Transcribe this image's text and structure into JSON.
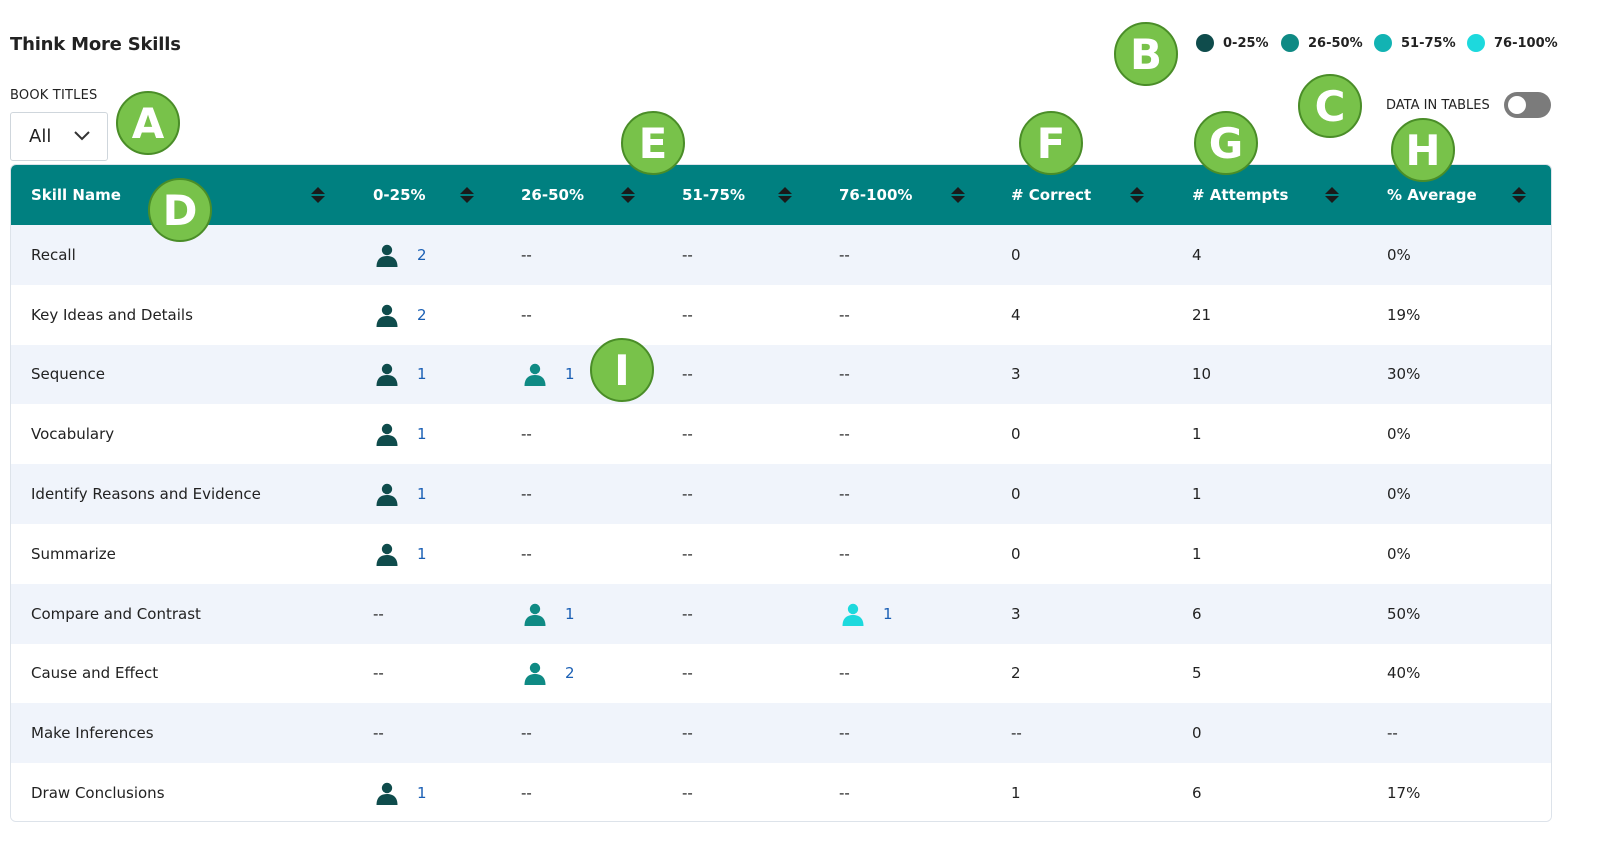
{
  "page": {
    "title": "Think More Skills"
  },
  "filter": {
    "label": "BOOK TITLES",
    "value": "All"
  },
  "legend": [
    {
      "label": "0-25%",
      "color": "#0f4c4c"
    },
    {
      "label": "26-50%",
      "color": "#0f8a84"
    },
    {
      "label": "51-75%",
      "color": "#12b3b3"
    },
    {
      "label": "76-100%",
      "color": "#1dd9dd"
    }
  ],
  "toggle": {
    "label": "DATA IN TABLES",
    "on": false
  },
  "table": {
    "columns": [
      "Skill Name",
      "0-25%",
      "26-50%",
      "51-75%",
      "76-100%",
      "# Correct",
      "# Attempts",
      "% Average"
    ],
    "rows": [
      {
        "name": "Recall",
        "b": [
          "2",
          "--",
          "--",
          "--"
        ],
        "correct": "0",
        "attempts": "4",
        "avg": "0%"
      },
      {
        "name": "Key Ideas and Details",
        "b": [
          "2",
          "--",
          "--",
          "--"
        ],
        "correct": "4",
        "attempts": "21",
        "avg": "19%"
      },
      {
        "name": "Sequence",
        "b": [
          "1",
          "1",
          "--",
          "--"
        ],
        "correct": "3",
        "attempts": "10",
        "avg": "30%"
      },
      {
        "name": "Vocabulary",
        "b": [
          "1",
          "--",
          "--",
          "--"
        ],
        "correct": "0",
        "attempts": "1",
        "avg": "0%"
      },
      {
        "name": "Identify Reasons and Evidence",
        "b": [
          "1",
          "--",
          "--",
          "--"
        ],
        "correct": "0",
        "attempts": "1",
        "avg": "0%"
      },
      {
        "name": "Summarize",
        "b": [
          "1",
          "--",
          "--",
          "--"
        ],
        "correct": "0",
        "attempts": "1",
        "avg": "0%"
      },
      {
        "name": "Compare and Contrast",
        "b": [
          "--",
          "1",
          "--",
          "1"
        ],
        "correct": "3",
        "attempts": "6",
        "avg": "50%"
      },
      {
        "name": "Cause and Effect",
        "b": [
          "--",
          "2",
          "--",
          "--"
        ],
        "correct": "2",
        "attempts": "5",
        "avg": "40%"
      },
      {
        "name": "Make Inferences",
        "b": [
          "--",
          "--",
          "--",
          "--"
        ],
        "correct": "--",
        "attempts": "0",
        "avg": "--"
      },
      {
        "name": "Draw Conclusions",
        "b": [
          "1",
          "--",
          "--",
          "--"
        ],
        "correct": "1",
        "attempts": "6",
        "avg": "17%"
      }
    ]
  },
  "callouts": [
    "A",
    "B",
    "C",
    "D",
    "E",
    "F",
    "G",
    "H",
    "I"
  ],
  "icons": {
    "person": "person-icon",
    "sort": "sort-icon",
    "chevron": "chevron-down-icon"
  }
}
